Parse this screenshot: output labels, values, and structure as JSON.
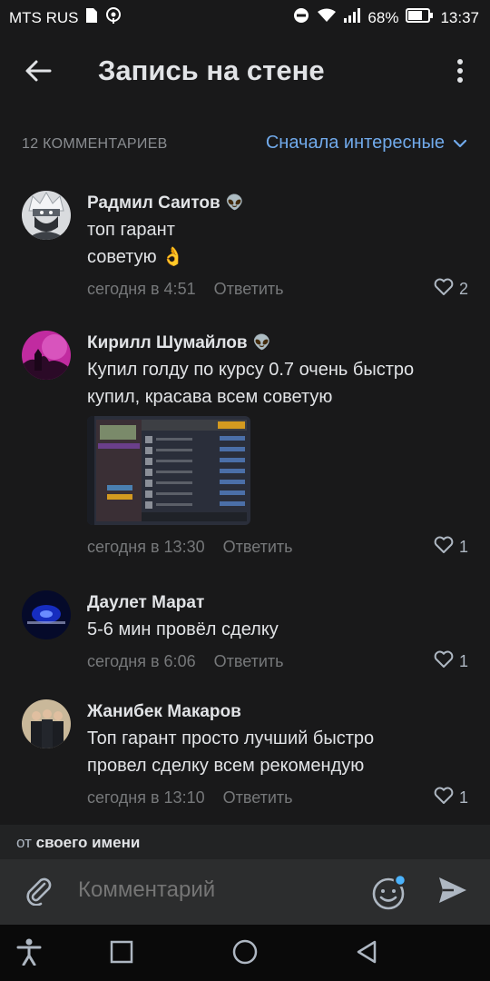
{
  "status_bar": {
    "carrier": "MTS RUS",
    "battery": "68%",
    "time": "13:37"
  },
  "header": {
    "title": "Запись на стене"
  },
  "comments_header": {
    "count": "12 КОММЕНТАРИЕВ",
    "sort": "Сначала интересные"
  },
  "comments": [
    {
      "author": "Радмил Саитов",
      "badge": "👽",
      "lines": [
        "топ гарант",
        "советую 👌"
      ],
      "time": "сегодня в 4:51",
      "reply": "Ответить",
      "likes": "2"
    },
    {
      "author": "Кирилл Шумайлов",
      "badge": "👽",
      "lines": [
        "Купил голду по курсу 0.7 очень быстро",
        "купил, красава всем советую"
      ],
      "time": "сегодня в 13:30",
      "reply": "Ответить",
      "likes": "1"
    },
    {
      "author": "Даулет Марат",
      "lines": [
        "5-6 мин провёл сделку"
      ],
      "time": "сегодня в 6:06",
      "reply": "Ответить",
      "likes": "1"
    },
    {
      "author": "Жанибек Макаров",
      "lines": [
        "Топ гарант просто лучший быстро",
        "провел сделку всем рекомендую"
      ],
      "time": "сегодня в 13:10",
      "reply": "Ответить",
      "likes": "1"
    }
  ],
  "footer": {
    "from_prefix": "от",
    "from_name": "своего имени",
    "input_placeholder": "Комментарий"
  },
  "icons": {
    "back": "arrow-left-icon",
    "menu": "more-vertical-icon",
    "sort": "chevron-down-icon",
    "like": "heart-icon",
    "attach": "paperclip-icon",
    "emoji": "smile-icon",
    "send": "send-icon"
  },
  "colors": {
    "background": "#19191a",
    "accent": "#71aaeb",
    "secondary_text": "#76787a",
    "composer": "#2c2d2e",
    "notification_dot": "#4bb3fd"
  }
}
